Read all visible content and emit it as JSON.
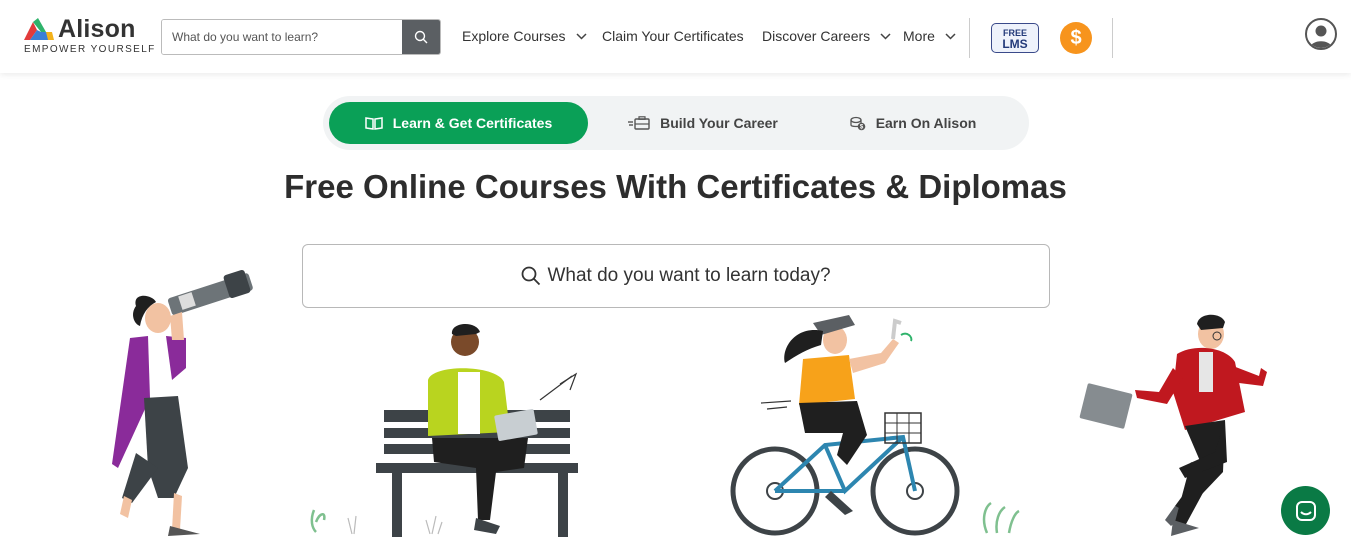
{
  "brand": {
    "name": "Alison",
    "tagline": "EMPOWER YOURSELF"
  },
  "header": {
    "search_placeholder": "What do you want to learn?",
    "nav": {
      "explore": "Explore Courses",
      "claim": "Claim Your Certificates",
      "careers": "Discover Careers",
      "more": "More"
    },
    "lms_badge": {
      "line1": "FREE",
      "line2": "LMS"
    },
    "coin_symbol": "$"
  },
  "tabs": [
    {
      "label": "Learn & Get Certificates",
      "icon": "book-icon",
      "active": true
    },
    {
      "label": "Build Your Career",
      "icon": "briefcase-icon",
      "active": false
    },
    {
      "label": "Earn On Alison",
      "icon": "coins-icon",
      "active": false
    }
  ],
  "hero": {
    "title": "Free Online Courses With Certificates & Diplomas",
    "search_placeholder": "What do you want to learn today?"
  },
  "colors": {
    "brand_green": "#0aa057",
    "coin_orange": "#f7941d",
    "chat_green": "#0a7a45"
  }
}
